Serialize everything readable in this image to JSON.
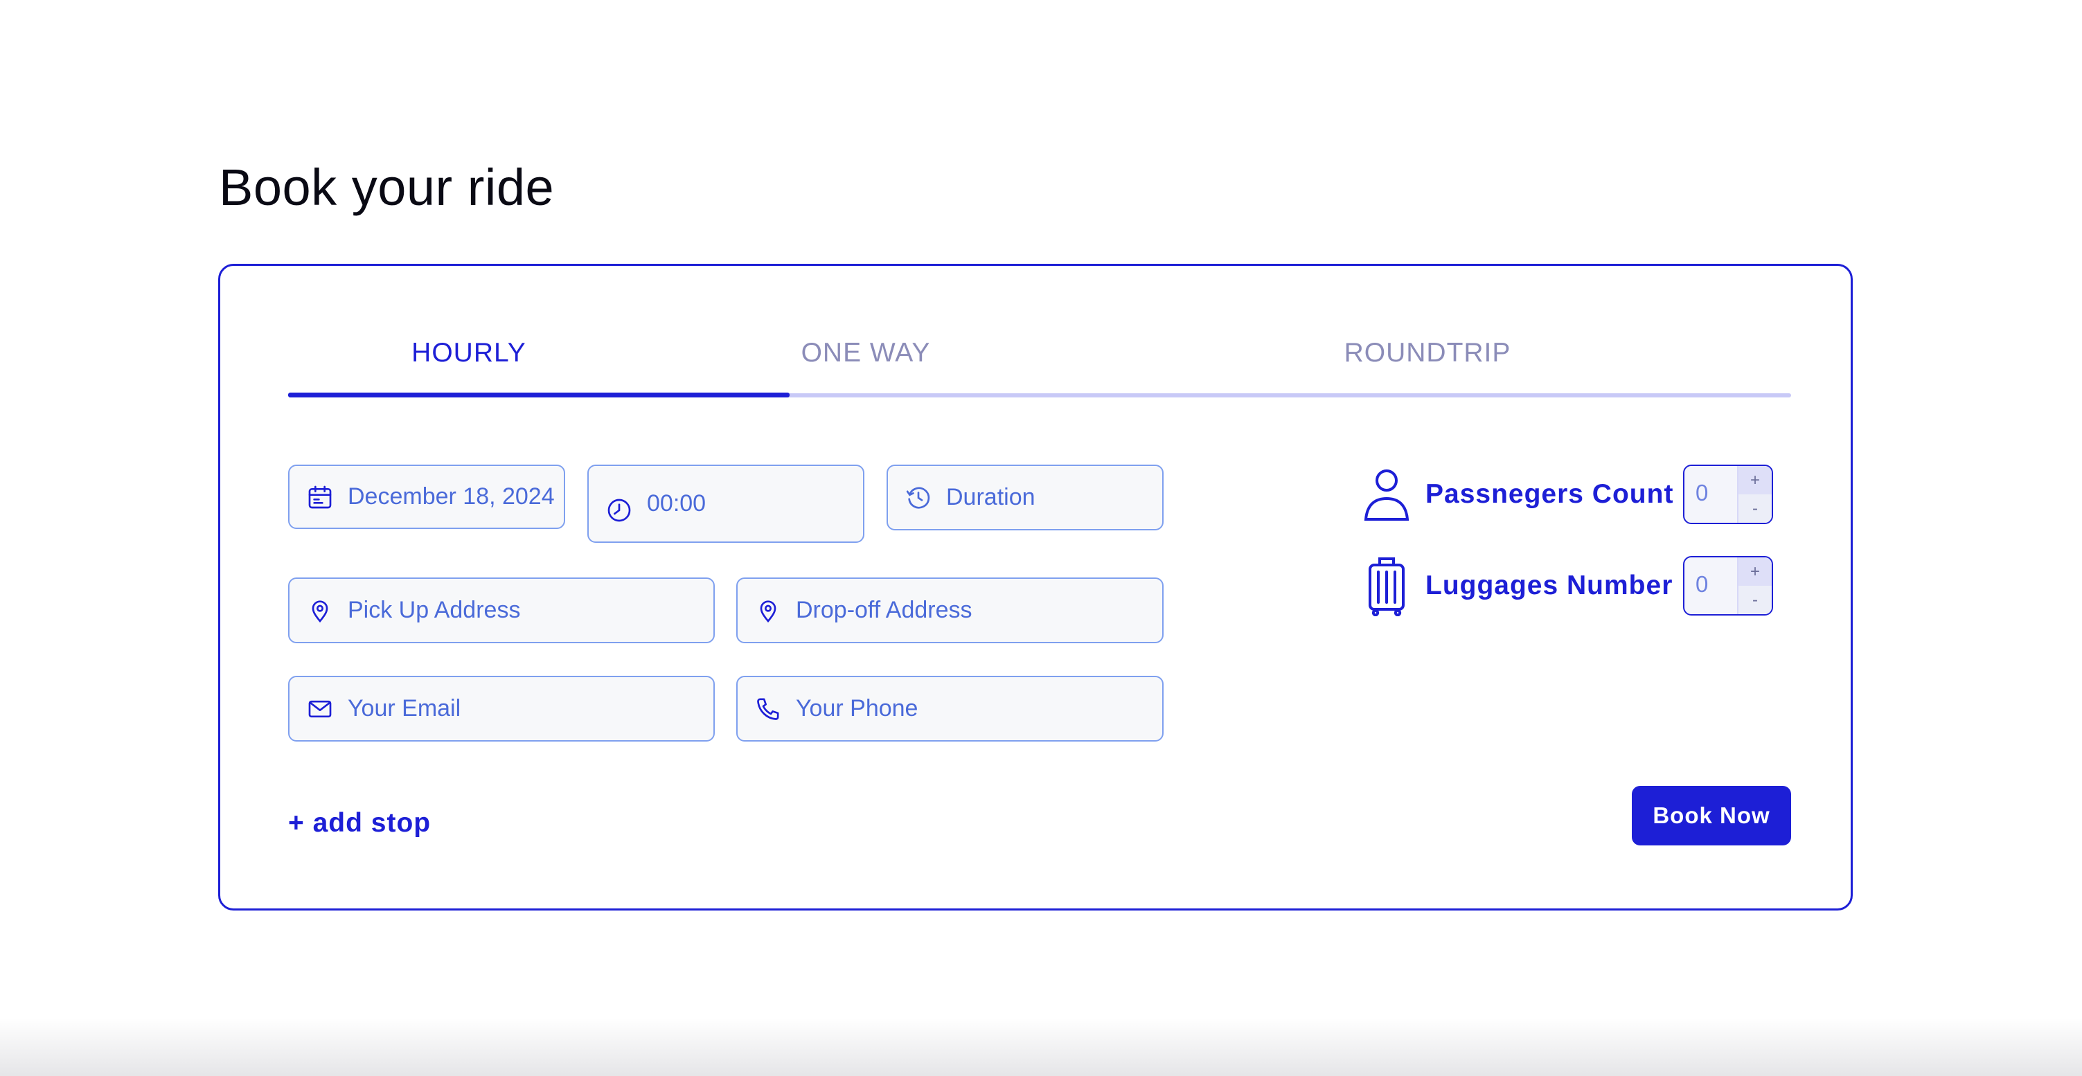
{
  "page": {
    "title": "Book your ride"
  },
  "tabs": [
    {
      "label": "HOURLY",
      "active": true
    },
    {
      "label": "ONE WAY",
      "active": false
    },
    {
      "label": "ROUNDTRIP",
      "active": false
    }
  ],
  "form": {
    "date": {
      "value": "December 18, 2024",
      "icon": "calendar-icon"
    },
    "time": {
      "value": "00:00",
      "icon": "clock-icon"
    },
    "duration": {
      "placeholder": "Duration",
      "icon": "history-icon"
    },
    "pickup": {
      "placeholder": "Pick Up Address",
      "icon": "location-pin-icon"
    },
    "dropoff": {
      "placeholder": "Drop-off Address",
      "icon": "location-pin-icon"
    },
    "email": {
      "placeholder": "Your Email",
      "icon": "mail-icon"
    },
    "phone": {
      "placeholder": "Your Phone",
      "icon": "phone-icon"
    }
  },
  "counters": {
    "passengers": {
      "label": "Passnegers Count",
      "value": "0",
      "plus": "+",
      "minus": "-",
      "icon": "person-icon"
    },
    "luggages": {
      "label": "Luggages Number",
      "value": "0",
      "plus": "+",
      "minus": "-",
      "icon": "suitcase-icon"
    }
  },
  "actions": {
    "add_stop": "+ add stop",
    "book_now": "Book Now"
  },
  "colors": {
    "accent": "#1d1fd6",
    "inactive_tab": "#8b8cb8",
    "field_border": "#7fa0ef",
    "field_text": "#4a6ad9",
    "field_bg": "#f7f8fa"
  }
}
